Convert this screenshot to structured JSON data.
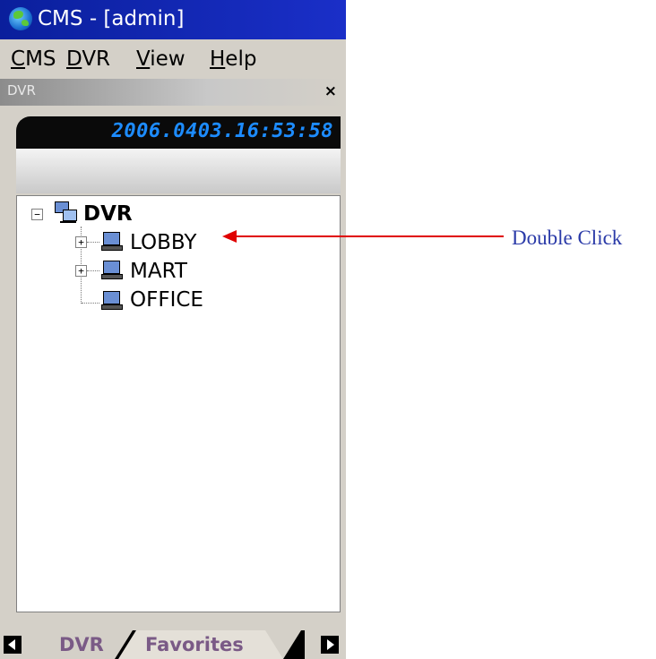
{
  "window": {
    "title": "CMS - [admin]"
  },
  "menu": {
    "items": [
      {
        "label": "CMS",
        "mnemonic": "C"
      },
      {
        "label": "DVR",
        "mnemonic": "D"
      },
      {
        "label": "View",
        "mnemonic": "V"
      },
      {
        "label": "Help",
        "mnemonic": "H"
      }
    ]
  },
  "panel": {
    "title": "DVR",
    "close_glyph": "×"
  },
  "clock": {
    "text": "2006.0403.16:53:58"
  },
  "tree": {
    "root": {
      "label": "DVR",
      "expanded": true,
      "icon": "network-icon"
    },
    "children": [
      {
        "label": "LOBBY",
        "expandable": true,
        "icon": "computer-icon"
      },
      {
        "label": "MART",
        "expandable": true,
        "icon": "computer-icon"
      },
      {
        "label": "OFFICE",
        "expandable": false,
        "icon": "computer-icon"
      }
    ]
  },
  "tabs": {
    "items": [
      "DVR",
      "Favorites"
    ],
    "active": "Favorites"
  },
  "annotation": {
    "text": "Double Click",
    "color": "#e00000",
    "text_color": "#2a3aa8"
  },
  "colors": {
    "titlebar": "#0a1f9c",
    "clock_digits": "#1d8cff",
    "tab_text": "#7a5a86"
  }
}
